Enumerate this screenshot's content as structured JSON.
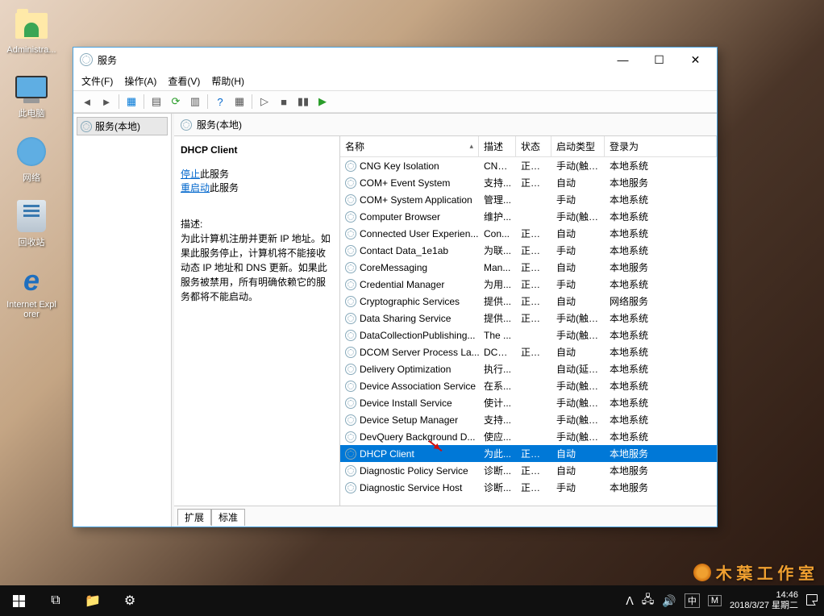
{
  "desktop": {
    "icons": [
      {
        "name": "administrator-folder",
        "label": "Administra..."
      },
      {
        "name": "this-pc",
        "label": "此电脑"
      },
      {
        "name": "network",
        "label": "网络"
      },
      {
        "name": "recycle-bin",
        "label": "回收站"
      },
      {
        "name": "ie",
        "label": "Internet Explorer"
      }
    ],
    "watermark": "木 葉 工 作 室"
  },
  "window": {
    "title": "服务",
    "menu": [
      "文件(F)",
      "操作(A)",
      "查看(V)",
      "帮助(H)"
    ],
    "left_item": "服务(本地)",
    "right_header": "服务(本地)",
    "detail": {
      "title": "DHCP Client",
      "stop_link": "停止",
      "stop_suffix": "此服务",
      "restart_link": "重启动",
      "restart_suffix": "此服务",
      "desc_label": "描述:",
      "desc_body": "为此计算机注册并更新 IP 地址。如果此服务停止，计算机将不能接收动态 IP 地址和 DNS 更新。如果此服务被禁用，所有明确依赖它的服务都将不能启动。"
    },
    "columns": [
      {
        "key": "name",
        "label": "名称",
        "w": "col-name",
        "sort": true
      },
      {
        "key": "desc",
        "label": "描述",
        "w": "col-desc"
      },
      {
        "key": "status",
        "label": "状态",
        "w": "col-status"
      },
      {
        "key": "start",
        "label": "启动类型",
        "w": "col-start"
      },
      {
        "key": "logon",
        "label": "登录为",
        "w": "col-logon"
      }
    ],
    "rows": [
      {
        "name": "CNG Key Isolation",
        "desc": "CNG...",
        "status": "正在...",
        "start": "手动(触发...",
        "logon": "本地系统"
      },
      {
        "name": "COM+ Event System",
        "desc": "支持...",
        "status": "正在...",
        "start": "自动",
        "logon": "本地服务"
      },
      {
        "name": "COM+ System Application",
        "desc": "管理...",
        "status": "",
        "start": "手动",
        "logon": "本地系统"
      },
      {
        "name": "Computer Browser",
        "desc": "维护...",
        "status": "",
        "start": "手动(触发...",
        "logon": "本地系统"
      },
      {
        "name": "Connected User Experien...",
        "desc": "Con...",
        "status": "正在...",
        "start": "自动",
        "logon": "本地系统"
      },
      {
        "name": "Contact Data_1e1ab",
        "desc": "为联...",
        "status": "正在...",
        "start": "手动",
        "logon": "本地系统"
      },
      {
        "name": "CoreMessaging",
        "desc": "Man...",
        "status": "正在...",
        "start": "自动",
        "logon": "本地服务"
      },
      {
        "name": "Credential Manager",
        "desc": "为用...",
        "status": "正在...",
        "start": "手动",
        "logon": "本地系统"
      },
      {
        "name": "Cryptographic Services",
        "desc": "提供...",
        "status": "正在...",
        "start": "自动",
        "logon": "网络服务"
      },
      {
        "name": "Data Sharing Service",
        "desc": "提供...",
        "status": "正在...",
        "start": "手动(触发...",
        "logon": "本地系统"
      },
      {
        "name": "DataCollectionPublishing...",
        "desc": "The ...",
        "status": "",
        "start": "手动(触发...",
        "logon": "本地系统"
      },
      {
        "name": "DCOM Server Process La...",
        "desc": "DCO...",
        "status": "正在...",
        "start": "自动",
        "logon": "本地系统"
      },
      {
        "name": "Delivery Optimization",
        "desc": "执行...",
        "status": "",
        "start": "自动(延迟...",
        "logon": "本地系统"
      },
      {
        "name": "Device Association Service",
        "desc": "在系...",
        "status": "",
        "start": "手动(触发...",
        "logon": "本地系统"
      },
      {
        "name": "Device Install Service",
        "desc": "使计...",
        "status": "",
        "start": "手动(触发...",
        "logon": "本地系统"
      },
      {
        "name": "Device Setup Manager",
        "desc": "支持...",
        "status": "",
        "start": "手动(触发...",
        "logon": "本地系统"
      },
      {
        "name": "DevQuery Background D...",
        "desc": "使应...",
        "status": "",
        "start": "手动(触发...",
        "logon": "本地系统"
      },
      {
        "name": "DHCP Client",
        "desc": "为此...",
        "status": "正在...",
        "start": "自动",
        "logon": "本地服务",
        "selected": true
      },
      {
        "name": "Diagnostic Policy Service",
        "desc": "诊断...",
        "status": "正在...",
        "start": "自动",
        "logon": "本地服务"
      },
      {
        "name": "Diagnostic Service Host",
        "desc": "诊断...",
        "status": "正在...",
        "start": "手动",
        "logon": "本地服务"
      }
    ],
    "tabs": [
      {
        "label": "扩展",
        "active": true
      },
      {
        "label": "标准",
        "active": false
      }
    ]
  },
  "taskbar": {
    "ime": [
      "中",
      "M"
    ],
    "time": "14:46",
    "date": "2018/3/27 星期二"
  }
}
